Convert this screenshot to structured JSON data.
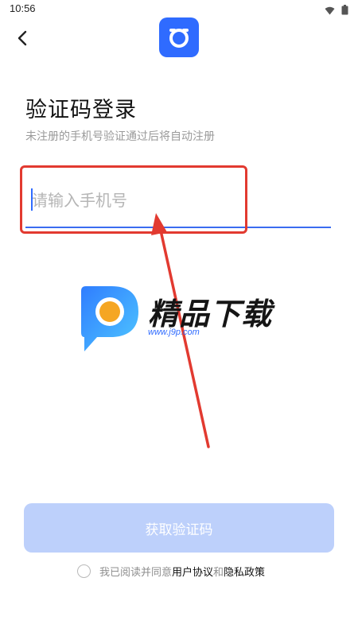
{
  "status_bar": {
    "time": "10:56",
    "icons": [
      "wifi-icon",
      "battery-icon"
    ]
  },
  "header": {
    "back_icon": "chevron-left-icon",
    "logo_icon": "app-logo-icon"
  },
  "login": {
    "title": "验证码登录",
    "subtitle": "未注册的手机号验证通过后将自动注册",
    "phone_placeholder": "请输入手机号",
    "phone_value": "",
    "get_code_label": "获取验证码"
  },
  "agreement": {
    "prefix": "我已阅读并同意",
    "user_agreement": "用户协议",
    "and": "和",
    "privacy_policy": "隐私政策",
    "checked": false
  },
  "watermark": {
    "name": "精品下载",
    "url": "www.j9p.com"
  },
  "colors": {
    "accent": "#2f6bff",
    "button_disabled": "#bdd0fb",
    "highlight": "#e23a30"
  }
}
